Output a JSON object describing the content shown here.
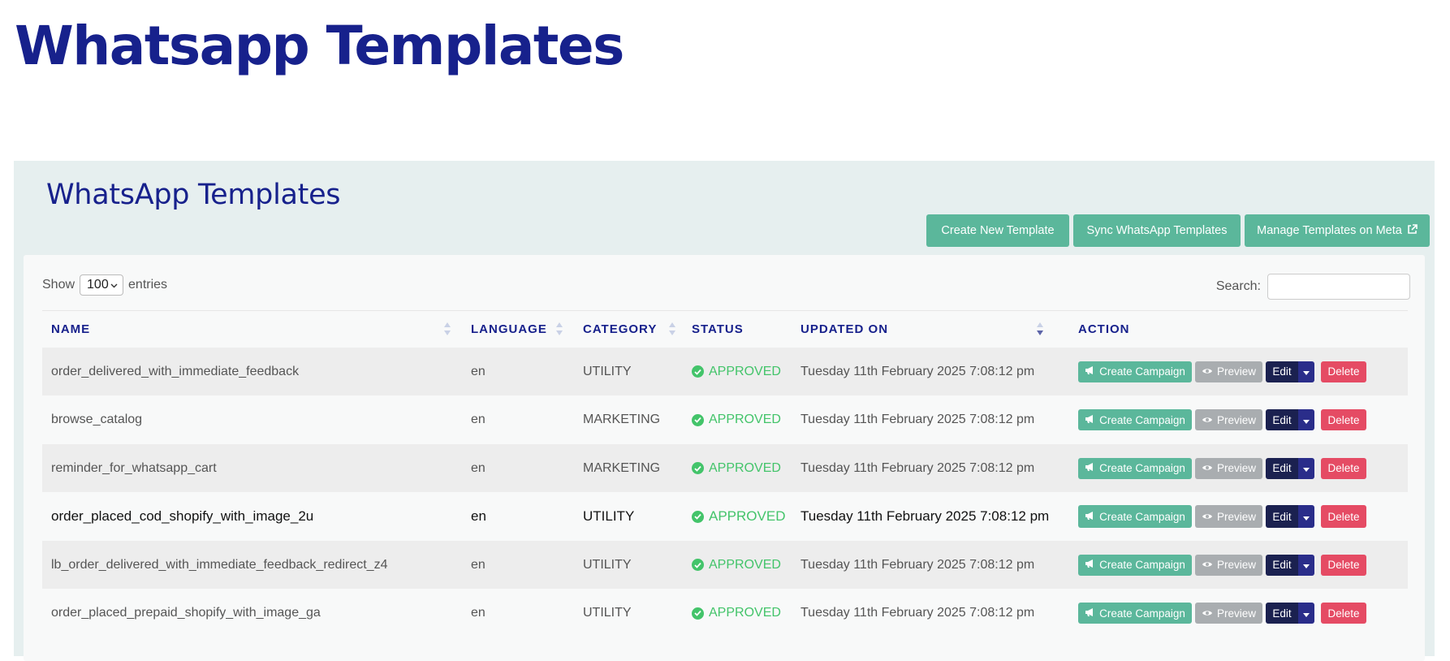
{
  "page": {
    "title": "Whatsapp Templates"
  },
  "panel": {
    "title": "WhatsApp Templates",
    "buttons": {
      "create_new": "Create New Template",
      "sync": "Sync WhatsApp Templates",
      "manage_meta": "Manage Templates on Meta"
    }
  },
  "table_controls": {
    "show_label": "Show",
    "entries_value": "100",
    "entries_label": "entries",
    "search_label": "Search:",
    "search_value": ""
  },
  "columns": {
    "name": "NAME",
    "language": "LANGUAGE",
    "category": "CATEGORY",
    "status": "STATUS",
    "updated_on": "UPDATED ON",
    "action": "ACTION"
  },
  "action_labels": {
    "create_campaign": "Create Campaign",
    "preview": "Preview",
    "edit": "Edit",
    "delete": "Delete"
  },
  "rows": [
    {
      "name": "order_delivered_with_immediate_feedback",
      "language": "en",
      "category": "UTILITY",
      "status": "APPROVED",
      "updated_on": "Tuesday 11th February 2025 7:08:12 pm"
    },
    {
      "name": "browse_catalog",
      "language": "en",
      "category": "MARKETING",
      "status": "APPROVED",
      "updated_on": "Tuesday 11th February 2025 7:08:12 pm"
    },
    {
      "name": "reminder_for_whatsapp_cart",
      "language": "en",
      "category": "MARKETING",
      "status": "APPROVED",
      "updated_on": "Tuesday 11th February 2025 7:08:12 pm"
    },
    {
      "name": "order_placed_cod_shopify_with_image_2u",
      "language": "en",
      "category": "UTILITY",
      "status": "APPROVED",
      "updated_on": "Tuesday 11th February 2025 7:08:12 pm"
    },
    {
      "name": "lb_order_delivered_with_immediate_feedback_redirect_z4",
      "language": "en",
      "category": "UTILITY",
      "status": "APPROVED",
      "updated_on": "Tuesday 11th February 2025 7:08:12 pm"
    },
    {
      "name": "order_placed_prepaid_shopify_with_image_ga",
      "language": "en",
      "category": "UTILITY",
      "status": "APPROVED",
      "updated_on": "Tuesday 11th February 2025 7:08:12 pm"
    }
  ],
  "colors": {
    "title_navy": "#17218c",
    "accent_green": "#5bb79b",
    "status_green": "#43c46a",
    "delete_red": "#e54b64",
    "edit_navy": "#1b2150"
  },
  "icons": {
    "create_campaign": "megaphone-icon",
    "preview": "eye-icon",
    "manage_meta": "external-link-icon",
    "status": "check-circle-icon",
    "edit_dropdown": "caret-down-icon"
  }
}
